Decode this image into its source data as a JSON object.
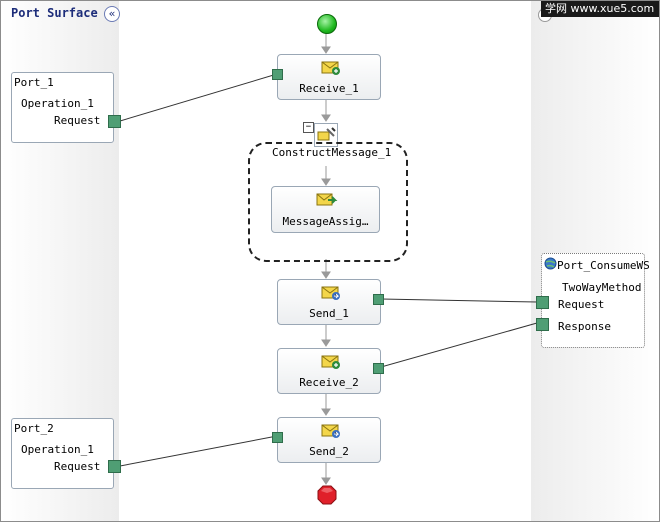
{
  "header": {
    "port_surface_title": "Port Surface",
    "collapse_icon": "double-chevron-left-icon",
    "watermark": "学网 www.xue5.com"
  },
  "ports_left": [
    {
      "name": "Port_1",
      "operation": "Operation_1",
      "message": "Request"
    },
    {
      "name": "Port_2",
      "operation": "Operation_1",
      "message": "Request"
    }
  ],
  "port_right": {
    "name": "Port_ConsumeWS",
    "operation": "TwoWayMethod",
    "request": "Request",
    "response": "Response"
  },
  "orchestration": {
    "receive_1": "Receive_1",
    "construct": "ConstructMessage_1",
    "assign": "MessageAssig…",
    "send_1": "Send_1",
    "receive_2": "Receive_2",
    "send_2": "Send_2"
  },
  "colors": {
    "connector": "#4f9e74",
    "start": "#1fb91f",
    "stop": "#e0202a",
    "title": "#1d2d7a"
  }
}
